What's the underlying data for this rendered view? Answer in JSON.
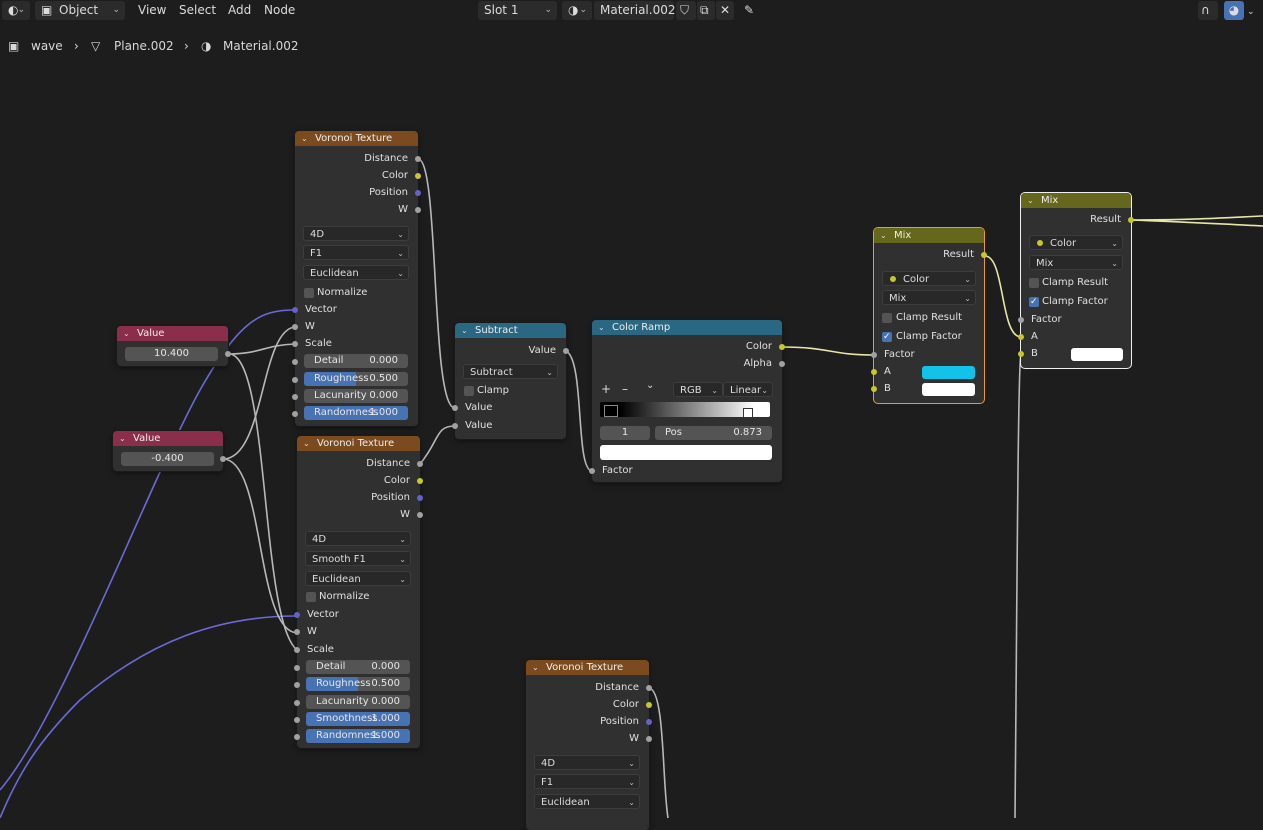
{
  "header": {
    "mode": "Object",
    "menus": [
      "View",
      "Select",
      "Add",
      "Node"
    ],
    "slot": "Slot 1",
    "material": "Material.002"
  },
  "breadcrumb": {
    "object": "wave",
    "mesh": "Plane.002",
    "material": "Material.002"
  },
  "nodes": {
    "vor1": {
      "title": "Voronoi Texture",
      "outputs": [
        "Distance",
        "Color",
        "Position",
        "W"
      ],
      "dims": "4D",
      "feature": "F1",
      "metric": "Euclidean",
      "normalize": "Normalize",
      "inputs": [
        "Vector",
        "W",
        "Scale"
      ],
      "detail": {
        "label": "Detail",
        "value": "0.000"
      },
      "roughness": {
        "label": "Roughness",
        "value": "0.500",
        "fraction": 0.5
      },
      "lacunarity": {
        "label": "Lacunarity",
        "value": "0.000"
      },
      "randomness": {
        "label": "Randomness",
        "value": "1.000",
        "fraction": 1.0
      }
    },
    "vor2": {
      "title": "Voronoi Texture",
      "outputs": [
        "Distance",
        "Color",
        "Position",
        "W"
      ],
      "dims": "4D",
      "feature": "Smooth F1",
      "metric": "Euclidean",
      "normalize": "Normalize",
      "inputs": [
        "Vector",
        "W",
        "Scale"
      ],
      "detail": {
        "label": "Detail",
        "value": "0.000"
      },
      "roughness": {
        "label": "Roughness",
        "value": "0.500",
        "fraction": 0.5
      },
      "lacunarity": {
        "label": "Lacunarity",
        "value": "0.000"
      },
      "smoothness": {
        "label": "Smoothness",
        "value": "1.000",
        "fraction": 1.0
      },
      "randomness": {
        "label": "Randomness",
        "value": "1.000",
        "fraction": 1.0
      }
    },
    "vor3": {
      "title": "Voronoi Texture",
      "outputs": [
        "Distance",
        "Color",
        "Position",
        "W"
      ],
      "dims": "4D",
      "feature": "F1",
      "metric": "Euclidean"
    },
    "value1": {
      "title": "Value",
      "value": "10.400"
    },
    "value2": {
      "title": "Value",
      "value": "-0.400"
    },
    "subtract": {
      "title": "Subtract",
      "output": "Value",
      "operation": "Subtract",
      "clamp": "Clamp",
      "inputs": [
        "Value",
        "Value"
      ]
    },
    "ramp": {
      "title": "Color Ramp",
      "outputs": [
        "Color",
        "Alpha"
      ],
      "add": "+",
      "remove": "–",
      "color_mode": "RGB",
      "interpolation": "Linear",
      "index": "1",
      "pos_label": "Pos",
      "pos_value": "0.873",
      "input": "Factor"
    },
    "mix1": {
      "title": "Mix",
      "output": "Result",
      "data_type": "Color",
      "blend": "Mix",
      "clamp_result": "Clamp Result",
      "clamp_factor": "Clamp Factor",
      "inputs": [
        "Factor",
        "A",
        "B"
      ],
      "color_a": "#12c2e8",
      "color_b": "#ffffff"
    },
    "mix2": {
      "title": "Mix",
      "output": "Result",
      "data_type": "Color",
      "blend": "Mix",
      "clamp_result": "Clamp Result",
      "clamp_factor": "Clamp Factor",
      "inputs": [
        "Factor",
        "A",
        "B"
      ],
      "color_b": "#ffffff"
    }
  },
  "colors": {
    "background": "#1d1d1d",
    "texture_header": "#7b4a1e",
    "converter_header": "#2a6783",
    "mix_header": "#64671c",
    "value_header": "#8b2e4b",
    "socket_float": "#a1a1a1",
    "socket_color": "#c7c729",
    "socket_vector": "#6363c7",
    "slider_fill": "#4772b3"
  }
}
